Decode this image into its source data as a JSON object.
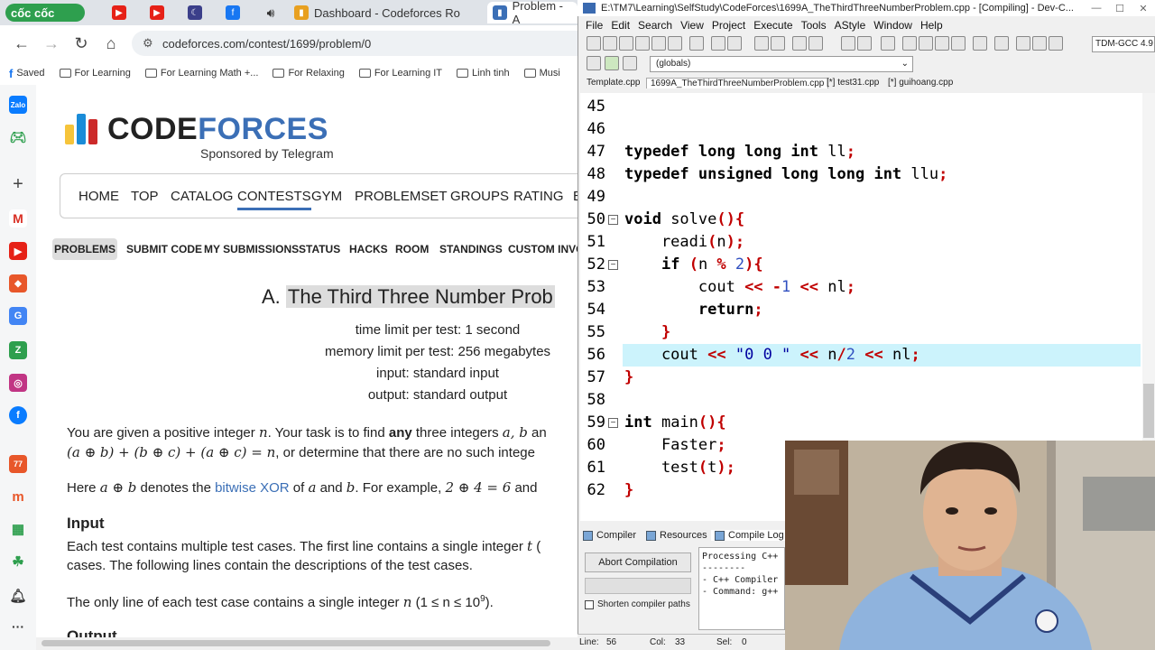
{
  "browser": {
    "brand": "cốc cốc",
    "tabs": [
      {
        "label": "",
        "icon": "youtube-icon"
      },
      {
        "label": "",
        "icon": "youtube-icon"
      },
      {
        "label": "",
        "icon": "moon-icon"
      },
      {
        "label": "",
        "icon": "facebook-icon"
      },
      {
        "label": "",
        "icon": "speaker-icon"
      },
      {
        "label": "Dashboard - Codeforces Ro",
        "icon": "chart-icon"
      },
      {
        "label": "Problem - A",
        "icon": "chart-icon"
      }
    ],
    "url": "codeforces.com/contest/1699/problem/0",
    "bookmarks": [
      "Saved",
      "For Learning",
      "For Learning Math +...",
      "For Relaxing",
      "For Learning IT",
      "Linh tinh",
      "Musi"
    ]
  },
  "codeforces": {
    "logo_a": "CODE",
    "logo_b": "FORCES",
    "sponsor": "Sponsored by Telegram",
    "menu": [
      "HOME",
      "TOP",
      "CATALOG",
      "CONTESTS",
      "GYM",
      "PROBLEMSET",
      "GROUPS",
      "RATING",
      "E"
    ],
    "submenu": [
      "PROBLEMS",
      "SUBMIT CODE",
      "MY SUBMISSIONS",
      "STATUS",
      "HACKS",
      "ROOM",
      "STANDINGS",
      "CUSTOM INVOC"
    ],
    "problem_letter": "A.",
    "problem_title": "The Third Three Number Prob",
    "time_limit": "time limit per test: 1 second",
    "memory_limit": "memory limit per test: 256 megabytes",
    "input": "input: standard input",
    "output": "output: standard output",
    "statement1a": "You are given a positive integer ",
    "statement1b": ". Your task is to find ",
    "statement1c": "any",
    "statement1d": " three integers ",
    "statement1e": " an",
    "statement2a": "(a ⊕ b) + (b ⊕ c) + (a ⊕ c) = n",
    "statement2b": ", or determine that there are no such intege",
    "xor_a": "Here ",
    "xor_b": "a ⊕ b",
    "xor_c": " denotes the ",
    "xor_link": "bitwise XOR",
    "xor_d": " of ",
    "xor_e": " and ",
    "xor_f": ". For example, ",
    "xor_g": "2 ⊕ 4 = 6",
    "xor_h": " and ",
    "input_heading": "Input",
    "input1a": "Each test contains multiple test cases. The first line contains a single integer ",
    "input1b": " (",
    "input2": "cases. The following lines contain the descriptions of the test cases.",
    "input3a": "The only line of each test case contains a single integer ",
    "input3b": " (1 ≤ n ≤ 10",
    "input3c": "9",
    "input3d": ").",
    "output_heading": "Output"
  },
  "ide": {
    "title": "E:\\TM7\\Learning\\SelfStudy\\CodeForces\\1699A_TheThirdThreeNumberProblem.cpp - [Compiling] - Dev-C...",
    "menu": [
      "File",
      "Edit",
      "Search",
      "View",
      "Project",
      "Execute",
      "Tools",
      "AStyle",
      "Window",
      "Help"
    ],
    "compiler": "TDM-GCC 4.9",
    "globals": "(globals)",
    "file_tabs": [
      "Template.cpp",
      "1699A_TheThirdThreeNumberProblem.cpp",
      "[*] test31.cpp",
      "[*] guihoang.cpp"
    ],
    "line_numbers": [
      "45",
      "46",
      "47",
      "48",
      "49",
      "50",
      "51",
      "52",
      "53",
      "54",
      "55",
      "56",
      "57",
      "58",
      "59",
      "60",
      "61",
      "62"
    ],
    "bottom_tabs": [
      "Compiler",
      "Resources",
      "Compile Log"
    ],
    "abort": "Abort Compilation",
    "shorten": "Shorten compiler paths",
    "log": [
      "Processing C++",
      "--------",
      "- C++ Compiler",
      "- Command: g++"
    ],
    "status": {
      "line_label": "Line:",
      "line": "56",
      "col_label": "Col:",
      "col": "33",
      "sel_label": "Sel:",
      "sel": "0"
    }
  },
  "colors": {
    "accent": "#3b6fb6",
    "highlight": "#ccf3fc",
    "symbol": "#c00000"
  }
}
